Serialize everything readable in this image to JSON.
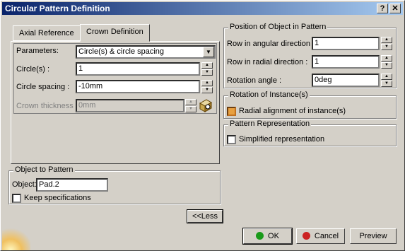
{
  "window": {
    "title": "Circular Pattern Definition",
    "help_label": "?",
    "close_label": "✕"
  },
  "tabs": [
    {
      "label": "Axial Reference"
    },
    {
      "label": "Crown Definition"
    }
  ],
  "crown": {
    "parameters_label": "Parameters:",
    "parameters_value": "Circle(s) & circle spacing",
    "circles_label": "Circle(s) :",
    "circles_value": "1",
    "spacing_label": "Circle  spacing :",
    "spacing_value": "-10mm",
    "thickness_label": "Crown thickness :",
    "thickness_value": "0mm"
  },
  "position_group": {
    "title": "Position of Object in Pattern",
    "angular_label": "Row in angular direction :",
    "angular_value": "1",
    "radial_label": "Row in radial direction :",
    "radial_value": "1",
    "rotation_label": "Rotation angle :",
    "rotation_value": "0deg"
  },
  "rotation_group": {
    "title": "Rotation of Instance(s)",
    "radial_alignment_label": "Radial alignment of instance(s)",
    "radial_alignment_checked": true
  },
  "representation_group": {
    "title": "Pattern Representation",
    "simplified_label": "Simplified representation",
    "simplified_checked": false
  },
  "object_group": {
    "title": "Object to Pattern",
    "object_label": "Object:",
    "object_value": "Pad.2",
    "keep_label": "Keep specifications",
    "keep_checked": false
  },
  "buttons": {
    "less": "<<Less",
    "ok": "OK",
    "cancel": "Cancel",
    "preview": "Preview"
  },
  "colors": {
    "titlebar_start": "#0a246a",
    "ok_dot": "#1a9a1a",
    "cancel_dot": "#cc2222"
  }
}
